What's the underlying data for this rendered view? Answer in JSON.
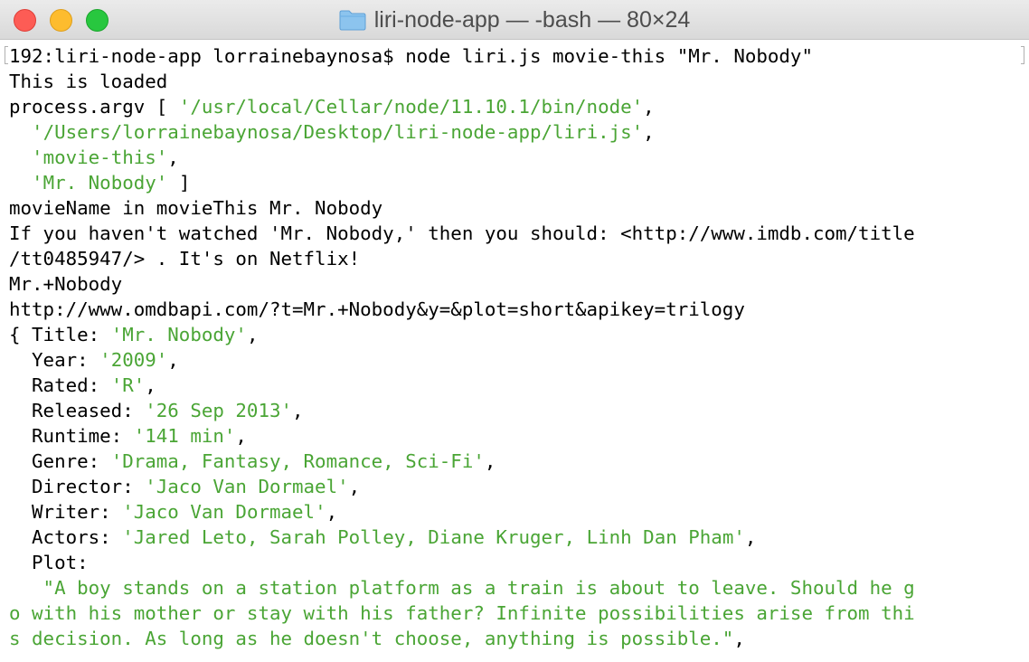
{
  "window": {
    "title": "liri-node-app — -bash — 80×24",
    "folder_icon": "folder-icon",
    "colors": {
      "close": "#fd5c55",
      "minimize": "#fdbc2e",
      "zoom": "#28c73f",
      "string": "#4aa535",
      "text": "#000000"
    }
  },
  "terminal": {
    "lines": [
      {
        "a": "192:liri-node-app lorrainebaynosa$ node liri.js movie-this \"Mr. Nobody\"",
        "b": "",
        "c": ""
      },
      {
        "a": "This is loaded",
        "b": "",
        "c": ""
      },
      {
        "a": "process.argv [ ",
        "b": "'/usr/local/Cellar/node/11.10.1/bin/node'",
        "c": ","
      },
      {
        "a": "  ",
        "b": "'/Users/lorrainebaynosa/Desktop/liri-node-app/liri.js'",
        "c": ","
      },
      {
        "a": "  ",
        "b": "'movie-this'",
        "c": ","
      },
      {
        "a": "  ",
        "b": "'Mr. Nobody'",
        "c": " ]"
      },
      {
        "a": "movieName in movieThis Mr. Nobody",
        "b": "",
        "c": ""
      },
      {
        "a": "If you haven't watched 'Mr. Nobody,' then you should: <http://www.imdb.com/title",
        "b": "",
        "c": ""
      },
      {
        "a": "/tt0485947/> . It's on Netflix!",
        "b": "",
        "c": ""
      },
      {
        "a": "Mr.+Nobody",
        "b": "",
        "c": ""
      },
      {
        "a": "http://www.omdbapi.com/?t=Mr.+Nobody&y=&plot=short&apikey=trilogy",
        "b": "",
        "c": ""
      },
      {
        "a": "{ Title: ",
        "b": "'Mr. Nobody'",
        "c": ","
      },
      {
        "a": "  Year: ",
        "b": "'2009'",
        "c": ","
      },
      {
        "a": "  Rated: ",
        "b": "'R'",
        "c": ","
      },
      {
        "a": "  Released: ",
        "b": "'26 Sep 2013'",
        "c": ","
      },
      {
        "a": "  Runtime: ",
        "b": "'141 min'",
        "c": ","
      },
      {
        "a": "  Genre: ",
        "b": "'Drama, Fantasy, Romance, Sci-Fi'",
        "c": ","
      },
      {
        "a": "  Director: ",
        "b": "'Jaco Van Dormael'",
        "c": ","
      },
      {
        "a": "  Writer: ",
        "b": "'Jaco Van Dormael'",
        "c": ","
      },
      {
        "a": "  Actors: ",
        "b": "'Jared Leto, Sarah Polley, Diane Kruger, Linh Dan Pham'",
        "c": ","
      },
      {
        "a": "  Plot:",
        "b": "",
        "c": ""
      },
      {
        "a": "",
        "b": "   \"A boy stands on a station platform as a train is about to leave. Should he g",
        "c": ""
      },
      {
        "a": "",
        "b": "o with his mother or stay with his father? Infinite possibilities arise from thi",
        "c": ""
      },
      {
        "a": "",
        "b": "s decision. As long as he doesn't choose, anything is possible.\"",
        "c": ","
      }
    ]
  }
}
